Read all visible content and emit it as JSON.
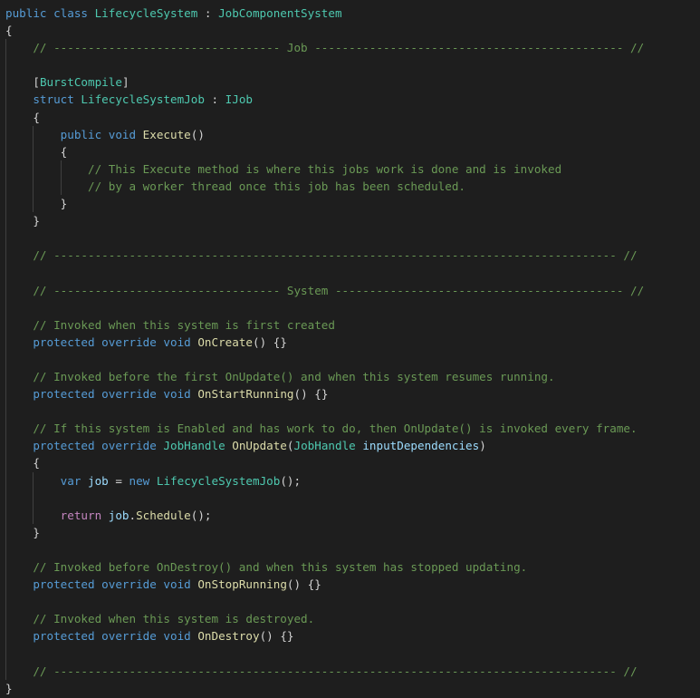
{
  "colors": {
    "background": "#1e1e1e",
    "keyword": "#569cd6",
    "control": "#c586c0",
    "type": "#4ec9b0",
    "function": "#dcdcaa",
    "variable": "#9cdcfe",
    "comment": "#6a9955",
    "punctuation": "#d4d4d4",
    "indent_guide": "#404040"
  },
  "lines": [
    {
      "indent": 0,
      "tokens": [
        [
          "kw",
          "public class "
        ],
        [
          "ty",
          "LifecycleSystem"
        ],
        [
          "pn",
          " : "
        ],
        [
          "ty",
          "JobComponentSystem"
        ]
      ]
    },
    {
      "indent": 0,
      "tokens": [
        [
          "pn",
          "{"
        ]
      ]
    },
    {
      "indent": 1,
      "tokens": [
        [
          "cm",
          "// --------------------------------- Job --------------------------------------------- //"
        ]
      ]
    },
    {
      "indent": 0,
      "tokens": []
    },
    {
      "indent": 1,
      "tokens": [
        [
          "pn",
          "["
        ],
        [
          "ty",
          "BurstCompile"
        ],
        [
          "pn",
          "]"
        ]
      ]
    },
    {
      "indent": 1,
      "tokens": [
        [
          "kw",
          "struct "
        ],
        [
          "ty",
          "LifecycleSystemJob"
        ],
        [
          "pn",
          " : "
        ],
        [
          "ty",
          "IJob"
        ]
      ]
    },
    {
      "indent": 1,
      "tokens": [
        [
          "pn",
          "{"
        ]
      ]
    },
    {
      "indent": 2,
      "tokens": [
        [
          "kw",
          "public void "
        ],
        [
          "fn",
          "Execute"
        ],
        [
          "pn",
          "()"
        ]
      ]
    },
    {
      "indent": 2,
      "tokens": [
        [
          "pn",
          "{"
        ]
      ]
    },
    {
      "indent": 3,
      "tokens": [
        [
          "cm",
          "// This Execute method is where this jobs work is done and is invoked"
        ]
      ]
    },
    {
      "indent": 3,
      "tokens": [
        [
          "cm",
          "// by a worker thread once this job has been scheduled."
        ]
      ]
    },
    {
      "indent": 2,
      "tokens": [
        [
          "pn",
          "}"
        ]
      ]
    },
    {
      "indent": 1,
      "tokens": [
        [
          "pn",
          "}"
        ]
      ]
    },
    {
      "indent": 0,
      "tokens": []
    },
    {
      "indent": 1,
      "tokens": [
        [
          "cm",
          "// ---------------------------------------------------------------------------------- //"
        ]
      ]
    },
    {
      "indent": 0,
      "tokens": []
    },
    {
      "indent": 1,
      "tokens": [
        [
          "cm",
          "// --------------------------------- System ------------------------------------------ //"
        ]
      ]
    },
    {
      "indent": 0,
      "tokens": []
    },
    {
      "indent": 1,
      "tokens": [
        [
          "cm",
          "// Invoked when this system is first created"
        ]
      ]
    },
    {
      "indent": 1,
      "tokens": [
        [
          "kw",
          "protected override void "
        ],
        [
          "fn",
          "OnCreate"
        ],
        [
          "pn",
          "() {}"
        ]
      ]
    },
    {
      "indent": 0,
      "tokens": []
    },
    {
      "indent": 1,
      "tokens": [
        [
          "cm",
          "// Invoked before the first OnUpdate() and when this system resumes running."
        ]
      ]
    },
    {
      "indent": 1,
      "tokens": [
        [
          "kw",
          "protected override void "
        ],
        [
          "fn",
          "OnStartRunning"
        ],
        [
          "pn",
          "() {}"
        ]
      ]
    },
    {
      "indent": 0,
      "tokens": []
    },
    {
      "indent": 1,
      "tokens": [
        [
          "cm",
          "// If this system is Enabled and has work to do, then OnUpdate() is invoked every frame."
        ]
      ]
    },
    {
      "indent": 1,
      "tokens": [
        [
          "kw",
          "protected override "
        ],
        [
          "ty",
          "JobHandle "
        ],
        [
          "fn",
          "OnUpdate"
        ],
        [
          "pn",
          "("
        ],
        [
          "ty",
          "JobHandle "
        ],
        [
          "var",
          "inputDependencies"
        ],
        [
          "pn",
          ")"
        ]
      ]
    },
    {
      "indent": 1,
      "tokens": [
        [
          "pn",
          "{"
        ]
      ]
    },
    {
      "indent": 2,
      "tokens": [
        [
          "kw",
          "var "
        ],
        [
          "var",
          "job"
        ],
        [
          "pn",
          " = "
        ],
        [
          "kw",
          "new "
        ],
        [
          "ty",
          "LifecycleSystemJob"
        ],
        [
          "pn",
          "();"
        ]
      ]
    },
    {
      "indent": 0,
      "tokens": []
    },
    {
      "indent": 2,
      "tokens": [
        [
          "ctl",
          "return "
        ],
        [
          "var",
          "job"
        ],
        [
          "pn",
          "."
        ],
        [
          "fn",
          "Schedule"
        ],
        [
          "pn",
          "();"
        ]
      ]
    },
    {
      "indent": 1,
      "tokens": [
        [
          "pn",
          "}"
        ]
      ]
    },
    {
      "indent": 0,
      "tokens": []
    },
    {
      "indent": 1,
      "tokens": [
        [
          "cm",
          "// Invoked before OnDestroy() and when this system has stopped updating."
        ]
      ]
    },
    {
      "indent": 1,
      "tokens": [
        [
          "kw",
          "protected override void "
        ],
        [
          "fn",
          "OnStopRunning"
        ],
        [
          "pn",
          "() {}"
        ]
      ]
    },
    {
      "indent": 0,
      "tokens": []
    },
    {
      "indent": 1,
      "tokens": [
        [
          "cm",
          "// Invoked when this system is destroyed."
        ]
      ]
    },
    {
      "indent": 1,
      "tokens": [
        [
          "kw",
          "protected override void "
        ],
        [
          "fn",
          "OnDestroy"
        ],
        [
          "pn",
          "() {}"
        ]
      ]
    },
    {
      "indent": 0,
      "tokens": []
    },
    {
      "indent": 1,
      "tokens": [
        [
          "cm",
          "// ---------------------------------------------------------------------------------- //"
        ]
      ]
    },
    {
      "indent": 0,
      "tokens": [
        [
          "pn",
          "}"
        ]
      ]
    }
  ]
}
